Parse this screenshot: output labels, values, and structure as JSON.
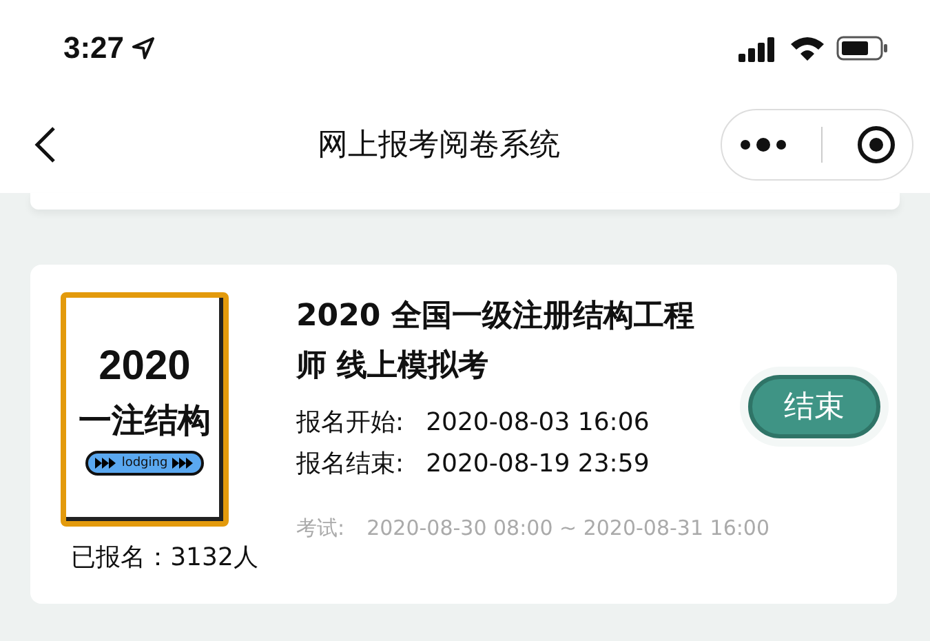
{
  "status_bar": {
    "time": "3:27"
  },
  "nav_bar": {
    "title": "网上报考阅卷系统"
  },
  "exam_card": {
    "cover": {
      "year": "2020",
      "subject": "一注结构",
      "tag": "lodging"
    },
    "enrolled": "已报名：3132人",
    "title": "2020 全国一级注册结构工程师 线上模拟考",
    "details": [
      {
        "label": "报名开始:",
        "value": "2020-08-03 16:06",
        "kind": "normal"
      },
      {
        "label": "报名结束:",
        "value": "2020-08-19 23:59",
        "kind": "normal"
      },
      {
        "label": "考试:",
        "value": "2020-08-30 08:00 ~ 2020-08-31 16:00",
        "kind": "muted"
      }
    ],
    "status_button": {
      "label": "结束"
    }
  }
}
